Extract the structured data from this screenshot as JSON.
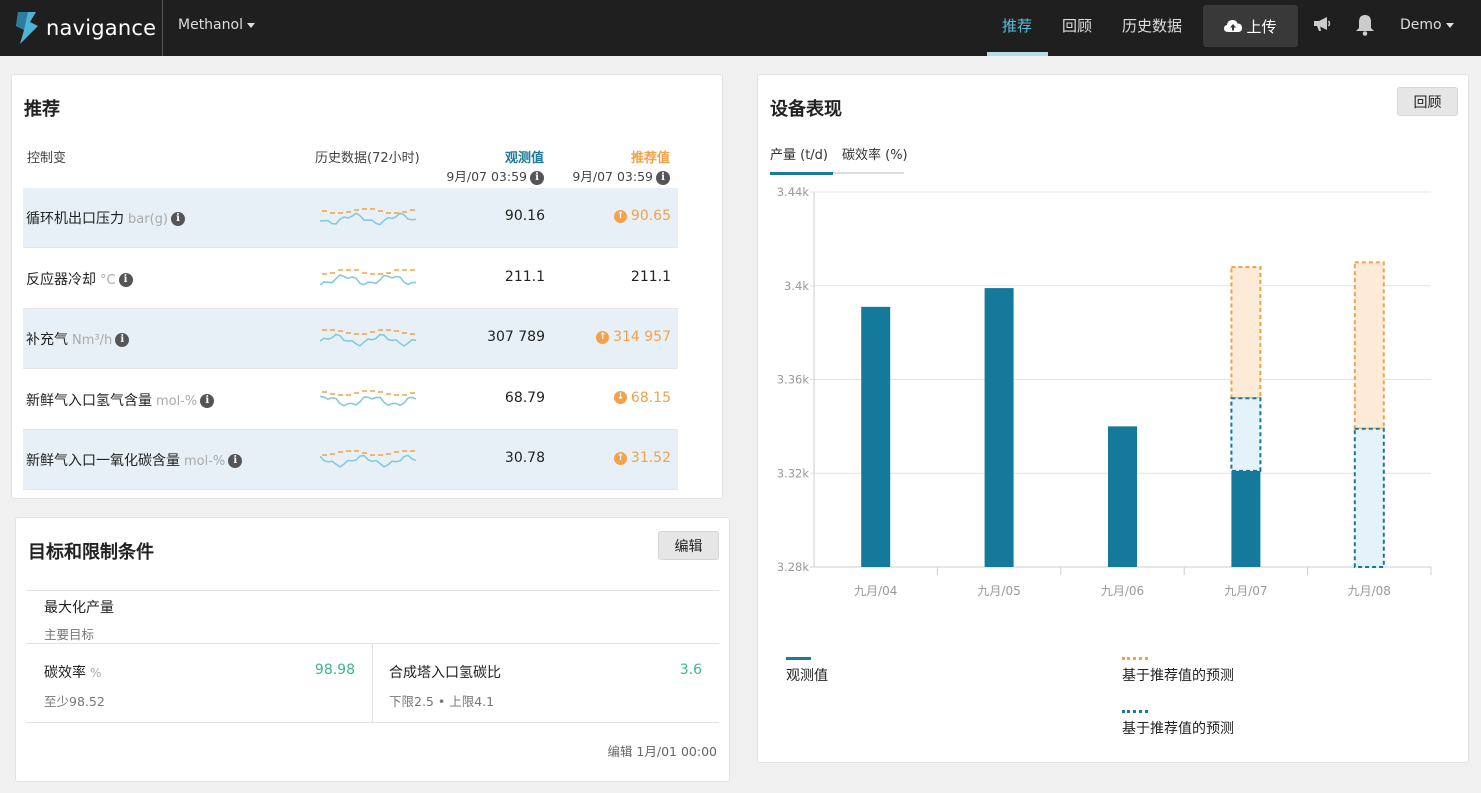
{
  "header": {
    "logo_text": "navigance",
    "product": "Methanol",
    "nav": [
      {
        "label": "推荐",
        "active": true
      },
      {
        "label": "回顾",
        "active": false
      },
      {
        "label": "历史数据",
        "active": false
      }
    ],
    "upload_label": "上传",
    "user": "Demo"
  },
  "recommendations": {
    "title": "推荐",
    "col_variable": "控制变",
    "col_history": "历史数据(72小时)",
    "col_observed": "观测值",
    "col_observed_time": "9月/07 03:59",
    "col_recommended": "推荐值",
    "col_recommended_time": "9月/07 03:59",
    "rows": [
      {
        "name": "循环机出口压力",
        "unit": "bar(g)",
        "observed": "90.16",
        "recommended": "90.65",
        "direction": "up",
        "highlight": true
      },
      {
        "name": "反应器冷却",
        "unit": "°C",
        "observed": "211.1",
        "recommended": "211.1",
        "direction": "",
        "highlight": false
      },
      {
        "name": "补充气",
        "unit": "Nm³/h",
        "observed": "307 789",
        "recommended": "314 957",
        "direction": "up",
        "highlight": true
      },
      {
        "name": "新鲜气入口氢气含量",
        "unit": "mol-%",
        "observed": "68.79",
        "recommended": "68.15",
        "direction": "down",
        "highlight": true
      },
      {
        "name": "新鲜气入口一氧化碳含量",
        "unit": "mol-%",
        "observed": "30.78",
        "recommended": "31.52",
        "direction": "up",
        "highlight": true
      }
    ]
  },
  "objectives": {
    "title": "目标和限制条件",
    "edit_label": "编辑",
    "primary": {
      "name": "最大化产量",
      "sub": "主要目标"
    },
    "constraints": [
      {
        "name": "碳效率",
        "unit": "%",
        "value": "98.98",
        "sub": "至少98.52"
      },
      {
        "name": "合成塔入口氢碳比",
        "unit": "",
        "value": "3.6",
        "sub": "下限2.5 • 上限4.1"
      }
    ],
    "footer": "编辑 1月/01 00:00"
  },
  "performance": {
    "title": "设备表现",
    "review_label": "回顾",
    "tabs": [
      {
        "label": "产量 (t/d)",
        "active": true
      },
      {
        "label": "碳效率 (%)",
        "active": false
      }
    ],
    "legend": [
      {
        "label": "观测值",
        "style": "solid",
        "color": "#1a7a9c"
      },
      {
        "label": "基于推荐值的预测",
        "style": "dotted",
        "color": "#f3a14a"
      },
      {
        "label": "基于推荐值的预测",
        "style": "dotted",
        "color": "#1a7a9c"
      }
    ]
  },
  "chart_data": {
    "type": "bar",
    "categories": [
      "九月/04",
      "九月/05",
      "九月/06",
      "九月/07",
      "九月/08"
    ],
    "yticks": [
      "3.28k",
      "3.32k",
      "3.36k",
      "3.4k",
      "3.44k"
    ],
    "ylim": [
      3280,
      3440
    ],
    "series": [
      {
        "name": "观测值",
        "values": [
          3391,
          3399,
          3340,
          3321,
          null
        ]
      },
      {
        "name": "基于推荐值的预测",
        "values": [
          null,
          null,
          null,
          3408,
          3410
        ]
      },
      {
        "name": "基于推荐值的预测",
        "values": [
          null,
          null,
          null,
          3352,
          3339
        ]
      }
    ],
    "colors": {
      "observed": "#15799b",
      "pred_orange": "#f3a14a",
      "pred_orange_fill": "#fdebd7",
      "pred_blue": "#15799b",
      "pred_blue_fill": "#e4f2f9"
    }
  }
}
